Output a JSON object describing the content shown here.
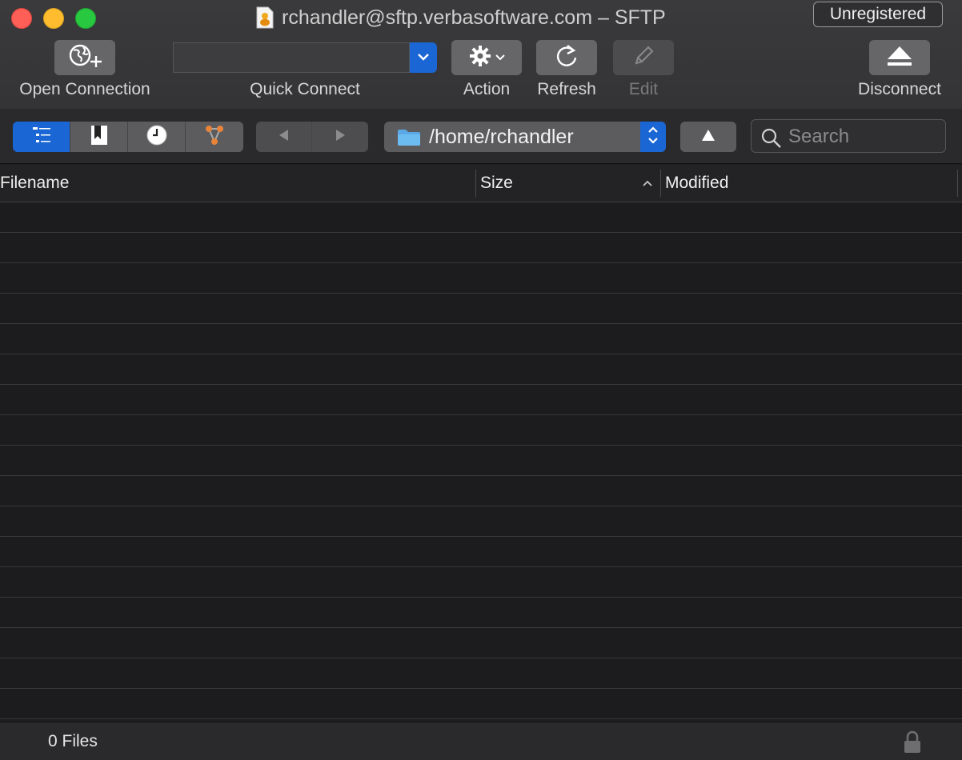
{
  "window": {
    "title": "rchandler@sftp.verbasoftware.com – SFTP",
    "badge": "Unregistered"
  },
  "toolbar": {
    "open_connection": "Open Connection",
    "quick_connect": "Quick Connect",
    "quick_connect_value": "",
    "action": "Action",
    "refresh": "Refresh",
    "edit": "Edit",
    "disconnect": "Disconnect"
  },
  "nav": {
    "path": "/home/rchandler",
    "search_placeholder": "Search"
  },
  "table": {
    "columns": [
      "Filename",
      "Size",
      "Modified"
    ],
    "sort_column": "Size",
    "sort_direction": "ascending",
    "rows": []
  },
  "status": {
    "file_count": "0 Files"
  },
  "colors": {
    "accent": "#1a66d4",
    "close": "#ff5f57",
    "minimize": "#febc2e",
    "maximize": "#28c840"
  }
}
